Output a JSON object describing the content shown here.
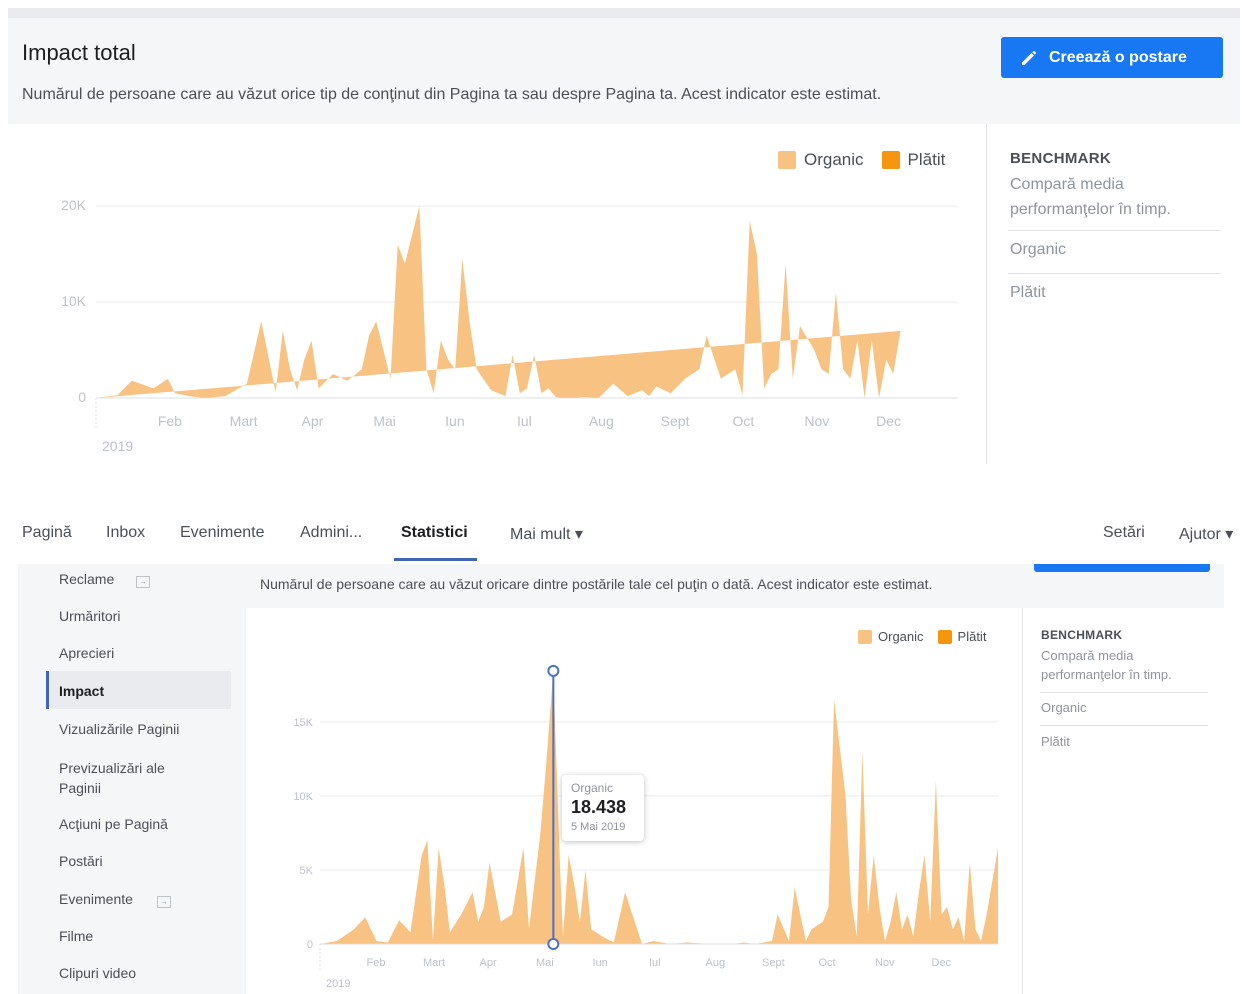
{
  "top_panel": {
    "title": "Impact total",
    "description": "Numărul de persoane care au văzut orice tip de conţinut din Pagina ta sau despre Pagina ta. Acest indicator este estimat.",
    "create_button_label": "Creează o postare",
    "legend": {
      "organic": "Organic",
      "paid": "Plătit"
    },
    "benchmark": {
      "title": "BENCHMARK",
      "subtitle": "Compară media performanţelor în timp.",
      "organic": "Organic",
      "paid": "Plătit"
    }
  },
  "nav": {
    "items": [
      "Pagină",
      "Inbox",
      "Evenimente",
      "Admini...",
      "Statistici",
      "Mai mult ▾"
    ],
    "active": "Statistici",
    "right_items": [
      "Setări",
      "Ajutor ▾"
    ]
  },
  "sidebar": {
    "items": [
      "Reclame",
      "Urmăritori",
      "Aprecieri",
      "Impact",
      "Vizualizările Paginii",
      "Previzualizări ale Paginii",
      "Acţiuni pe Pagină",
      "Postări",
      "Evenimente",
      "Filme",
      "Clipuri video"
    ],
    "active": "Impact"
  },
  "bottom_panel": {
    "description": "Numărul de persoane care au văzut oricare dintre postările tale cel puţin o dată. Acest indicator este estimat.",
    "legend": {
      "organic": "Organic",
      "paid": "Plătit"
    },
    "benchmark": {
      "title": "BENCHMARK",
      "subtitle": "Compară media performanţelor în timp.",
      "organic": "Organic",
      "paid": "Plătit"
    },
    "tooltip": {
      "label": "Organic",
      "value": "18.438",
      "date": "5 Mai 2019"
    }
  },
  "colors": {
    "organic": "#f8c283",
    "paid": "#f5960e",
    "accent": "#1877f2",
    "nav_active": "#4267b2",
    "hover_line": "#4a72c8"
  },
  "chart_data": [
    {
      "type": "area",
      "title": "Impact total",
      "year_label": "2019",
      "x_tick_labels": [
        "Feb",
        "Mart",
        "Apr",
        "Mai",
        "Iun",
        "Iul",
        "Aug",
        "Sept",
        "Oct",
        "Nov",
        "Dec"
      ],
      "y_ticks": [
        0,
        10000,
        20000
      ],
      "y_tick_labels": [
        "0",
        "10K",
        "20K"
      ],
      "ylim": [
        0,
        22000
      ],
      "x_range_months": [
        0.0,
        12.0
      ],
      "series": [
        {
          "name": "Organic",
          "x_months": [
            0.0,
            0.3,
            0.5,
            0.8,
            1.0,
            1.1,
            1.3,
            1.5,
            1.8,
            2.1,
            2.3,
            2.5,
            2.6,
            2.7,
            2.8,
            2.9,
            3.0,
            3.1,
            3.3,
            3.5,
            3.7,
            3.8,
            3.9,
            4.1,
            4.2,
            4.3,
            4.5,
            4.6,
            4.7,
            4.8,
            4.9,
            5.0,
            5.1,
            5.2,
            5.3,
            5.5,
            5.7,
            5.8,
            5.9,
            6.0,
            6.1,
            6.2,
            6.3,
            6.4,
            6.5,
            6.6,
            6.8,
            7.0,
            7.2,
            7.4,
            7.6,
            7.7,
            7.8,
            8.0,
            8.2,
            8.4,
            8.5,
            8.7,
            8.9,
            9.0,
            9.1,
            9.2,
            9.3,
            9.4,
            9.5,
            9.6,
            9.7,
            9.8,
            10.0,
            10.1,
            10.2,
            10.3,
            10.4,
            10.5,
            10.6,
            10.7,
            10.8,
            10.9,
            11.0,
            11.1,
            11.2,
            11.3,
            11.4,
            11.5,
            11.6,
            11.7,
            11.8,
            12.0
          ],
          "values": [
            0,
            300,
            1800,
            1000,
            2000,
            500,
            200,
            0,
            200,
            1500,
            8000,
            600,
            7000,
            3000,
            800,
            4000,
            6000,
            1000,
            2500,
            1800,
            3000,
            6500,
            8000,
            2000,
            16000,
            14000,
            20000,
            3000,
            500,
            6000,
            4000,
            3000,
            14500,
            8000,
            3000,
            800,
            200,
            4500,
            500,
            1000,
            4500,
            500,
            1000,
            100,
            0,
            0,
            100,
            0,
            1500,
            200,
            800,
            200,
            1200,
            500,
            2000,
            3000,
            6500,
            2000,
            3000,
            300,
            18500,
            15000,
            1000,
            2500,
            3000,
            14000,
            2000,
            7500,
            5000,
            3000,
            2500,
            11000,
            3000,
            2000,
            6000,
            0,
            6000,
            0,
            4000,
            2500,
            7000
          ]
        },
        {
          "name": "Plătit",
          "values": [
            0
          ]
        }
      ]
    },
    {
      "type": "area",
      "year_label": "2019",
      "x_tick_labels": [
        "Feb",
        "Mart",
        "Apr",
        "Mai",
        "Iun",
        "Iul",
        "Aug",
        "Sept",
        "Oct",
        "Nov",
        "Dec"
      ],
      "y_ticks": [
        0,
        5000,
        10000,
        15000
      ],
      "y_tick_labels": [
        "0",
        "5K",
        "10K",
        "15K"
      ],
      "ylim": [
        0,
        18500
      ],
      "x_range_months": [
        0.0,
        12.0
      ],
      "highlight": {
        "series": "Organic",
        "x_month": 4.13,
        "value": 18438,
        "date_label": "5 Mai 2019"
      },
      "series": [
        {
          "name": "Organic",
          "x_months": [
            0.0,
            0.3,
            0.6,
            0.8,
            1.0,
            1.2,
            1.4,
            1.6,
            1.8,
            1.9,
            2.0,
            2.1,
            2.2,
            2.3,
            2.5,
            2.7,
            2.8,
            2.9,
            3.0,
            3.2,
            3.4,
            3.6,
            3.7,
            3.9,
            4.0,
            4.13,
            4.25,
            4.3,
            4.4,
            4.5,
            4.6,
            4.7,
            4.8,
            5.0,
            5.2,
            5.4,
            5.7,
            5.9,
            6.2,
            6.5,
            6.9,
            7.1,
            7.3,
            7.5,
            7.7,
            8.0,
            8.1,
            8.3,
            8.4,
            8.6,
            8.7,
            8.9,
            9.0,
            9.1,
            9.3,
            9.4,
            9.5,
            9.6,
            9.7,
            9.8,
            9.9,
            10.0,
            10.1,
            10.2,
            10.3,
            10.4,
            10.5,
            10.6,
            10.7,
            10.8,
            10.9,
            11.0,
            11.1,
            11.2,
            11.3,
            11.4,
            11.5,
            11.6,
            11.7,
            11.8,
            12.0
          ],
          "values": [
            0,
            200,
            1000,
            1800,
            200,
            100,
            1600,
            800,
            6000,
            7000,
            200,
            6500,
            4000,
            800,
            2000,
            3500,
            1500,
            2500,
            5500,
            1500,
            2000,
            6500,
            1000,
            7500,
            12000,
            18438,
            5000,
            500,
            6000,
            4000,
            1500,
            5000,
            1000,
            500,
            100,
            3500,
            0,
            200,
            0,
            100,
            0,
            0,
            0,
            100,
            0,
            200,
            2000,
            200,
            3800,
            200,
            1000,
            1500,
            2500,
            16500,
            10000,
            3000,
            500,
            13000,
            2000,
            6000,
            2500,
            200,
            1500,
            3500,
            1000,
            2000,
            500,
            3500,
            6000,
            1500,
            11000,
            2000,
            2500,
            1000,
            1800,
            200,
            5500,
            1000,
            200,
            2000,
            6500
          ]
        },
        {
          "name": "Plătit",
          "values": [
            0
          ]
        }
      ]
    }
  ]
}
